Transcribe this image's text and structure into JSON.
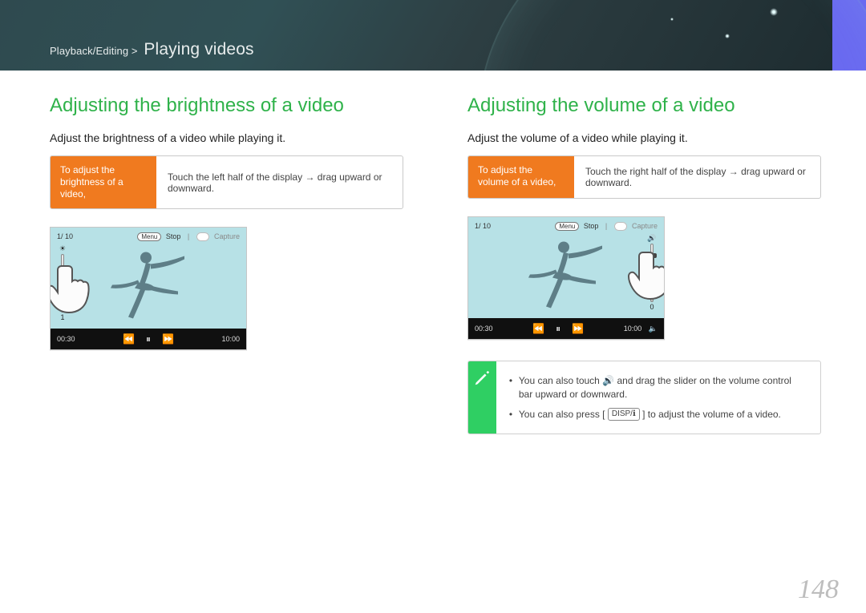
{
  "header": {
    "breadcrumb_prefix": "Playback/Editing >",
    "breadcrumb_title": "Playing videos"
  },
  "left": {
    "heading": "Adjusting the brightness of a video",
    "lede": "Adjust the brightness of a video while playing it.",
    "callout_label": "To adjust the brightness of a video,",
    "callout_value": "Touch the left half of the display → drag upward or downward.",
    "player": {
      "counter": "1/ 10",
      "menu": "Menu",
      "stop": "Stop",
      "capture": "Capture",
      "time_current": "00:30",
      "time_total": "10:00",
      "slider_icon_top": "☀",
      "slider_icon_bot": "1"
    }
  },
  "right": {
    "heading": "Adjusting the volume of a video",
    "lede": "Adjust the volume of a video while playing it.",
    "callout_label": "To adjust the volume of a video,",
    "callout_value": "Touch the right half of the display → drag upward or downward.",
    "player": {
      "counter": "1/ 10",
      "menu": "Menu",
      "stop": "Stop",
      "capture": "Capture",
      "time_current": "00:30",
      "time_total": "10:00",
      "slider_icon_top": "🔊",
      "slider_icon_bot": "0"
    },
    "tips": {
      "item1_a": "You can also touch ",
      "item1_b": " and drag the slider on the volume control bar upward or downward.",
      "item2_a": "You can also press [",
      "item2_chip": "DISP/",
      "item2_b": "] to adjust the volume of a video."
    }
  },
  "page_number": "148"
}
